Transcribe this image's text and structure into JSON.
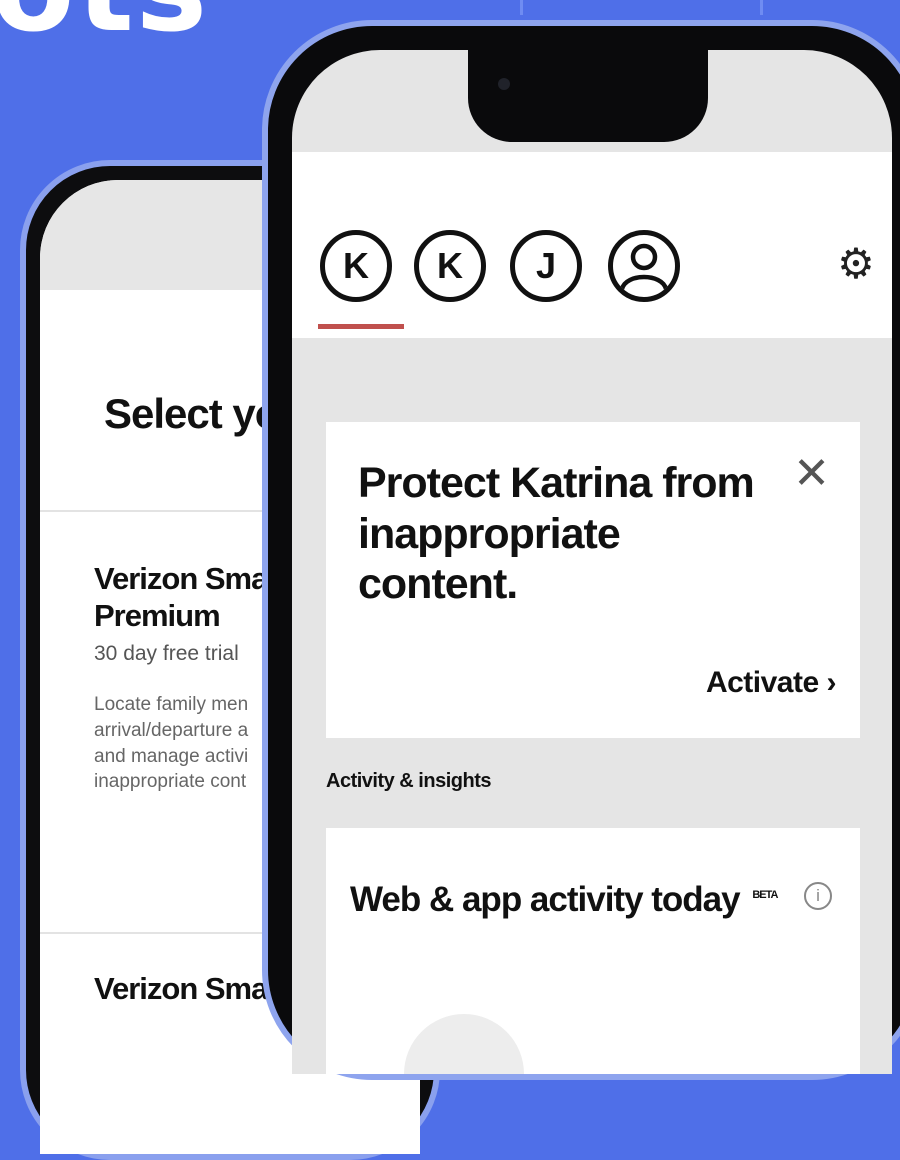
{
  "banner": {
    "text": "ots"
  },
  "back_phone": {
    "title": "Select you",
    "plans": [
      {
        "name_line1": "Verizon Smar",
        "name_line2": "Premium",
        "trial": "30 day free trial",
        "desc_lines": [
          "Locate family men",
          "arrival/departure a",
          "and manage activi",
          "inappropriate cont"
        ]
      },
      {
        "name_line1": "Verizon Smar"
      }
    ]
  },
  "front_phone": {
    "profiles": [
      "K",
      "K",
      "J"
    ],
    "card": {
      "title": "Protect Katrina from inappropriate content.",
      "close_glyph": "✕",
      "action_label": "Activate",
      "action_chevron": "›"
    },
    "section_header": "Activity & insights",
    "activity": {
      "title": "Web & app activity today",
      "badge": "BETA",
      "info_glyph": "i"
    },
    "icons": {
      "profile_add": "person-outline-icon",
      "settings": "gear-icon",
      "close": "close-icon",
      "info": "info-icon",
      "chevron": "chevron-right-icon"
    },
    "accent_color": "#c0504d"
  },
  "colors": {
    "background": "#4f6fe8"
  }
}
